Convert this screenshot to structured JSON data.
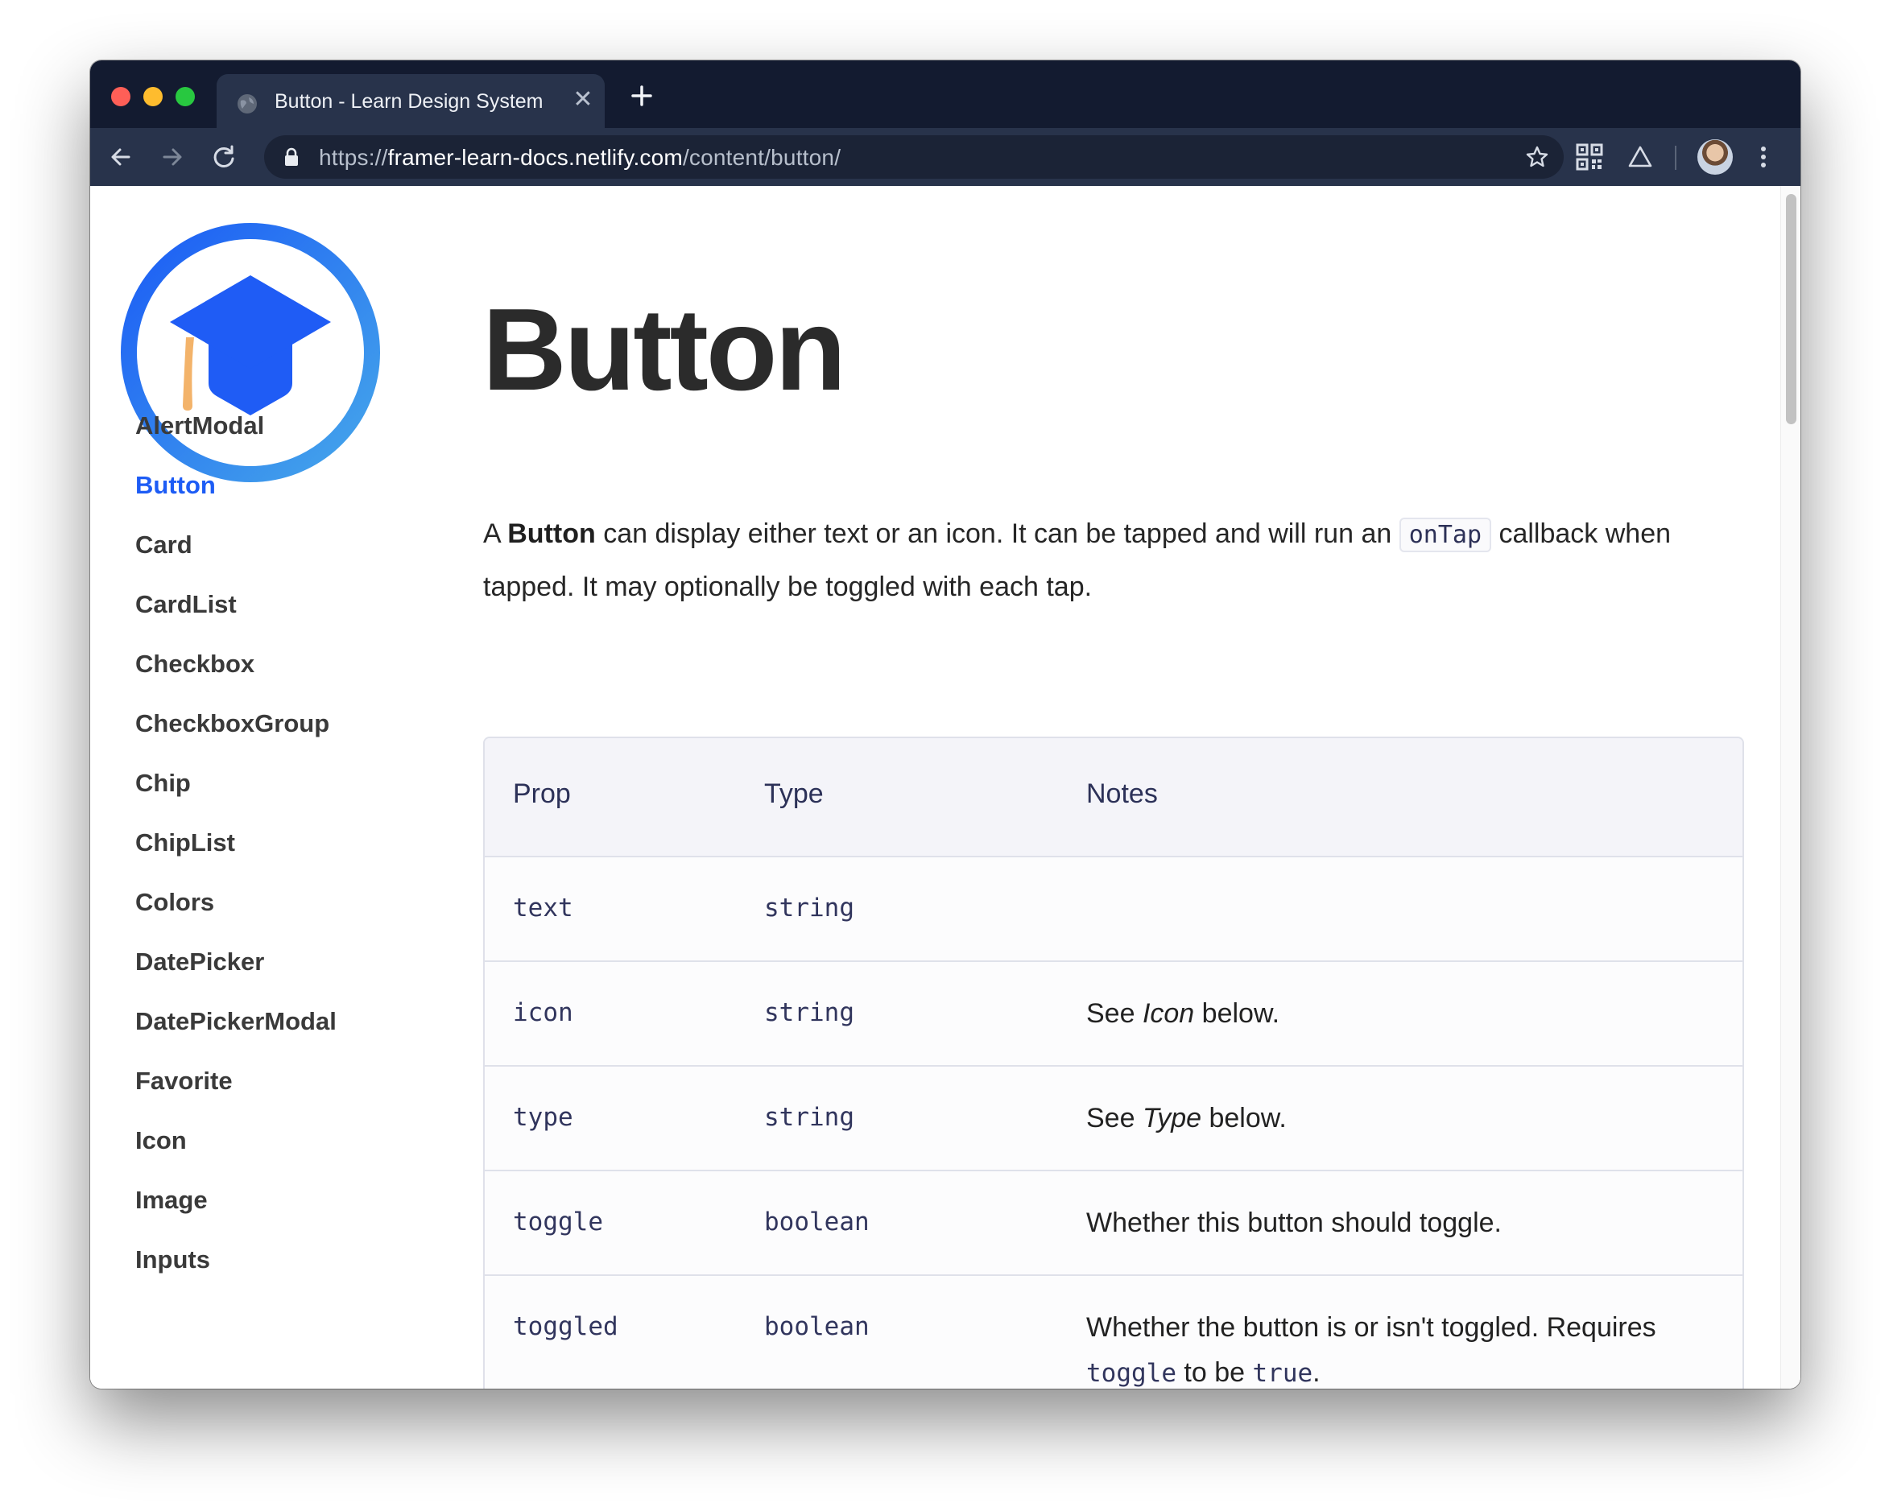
{
  "browser": {
    "tab": {
      "title": "Button - Learn Design System",
      "close_glyph": "✕"
    },
    "newtab_glyph": "+",
    "url": {
      "scheme": "https://",
      "host": "framer-learn-docs.netlify.com",
      "path": "/content/button/"
    },
    "icons": [
      "back-icon",
      "forward-icon",
      "reload-icon",
      "lock-icon",
      "star-icon",
      "qr-code-icon",
      "drive-icon",
      "profile-avatar",
      "menu-icon"
    ]
  },
  "sidebar": {
    "items": [
      {
        "label": "AlertModal",
        "active": false
      },
      {
        "label": "Button",
        "active": true
      },
      {
        "label": "Card",
        "active": false
      },
      {
        "label": "CardList",
        "active": false
      },
      {
        "label": "Checkbox",
        "active": false
      },
      {
        "label": "CheckboxGroup",
        "active": false
      },
      {
        "label": "Chip",
        "active": false
      },
      {
        "label": "ChipList",
        "active": false
      },
      {
        "label": "Colors",
        "active": false
      },
      {
        "label": "DatePicker",
        "active": false
      },
      {
        "label": "DatePickerModal",
        "active": false
      },
      {
        "label": "Favorite",
        "active": false
      },
      {
        "label": "Icon",
        "active": false
      },
      {
        "label": "Image",
        "active": false
      },
      {
        "label": "Inputs",
        "active": false
      }
    ]
  },
  "main": {
    "title": "Button",
    "intro": {
      "p1": "A ",
      "bold": "Button",
      "p2": " can display either text or an icon. It can be tapped and will run an ",
      "code": "onTap",
      "p3": " callback when tapped. It may optionally be toggled with each tap."
    },
    "table": {
      "headers": [
        "Prop",
        "Type",
        "Notes"
      ],
      "rows": [
        {
          "prop": "text",
          "type": "string",
          "note_parts": []
        },
        {
          "prop": "icon",
          "type": "string",
          "note_parts": [
            {
              "t": "See "
            },
            {
              "t": "Icon",
              "i": true
            },
            {
              "t": " below."
            }
          ]
        },
        {
          "prop": "type",
          "type": "string",
          "note_parts": [
            {
              "t": "See "
            },
            {
              "t": "Type",
              "i": true
            },
            {
              "t": " below."
            }
          ]
        },
        {
          "prop": "toggle",
          "type": "boolean",
          "note_parts": [
            {
              "t": "Whether this button should toggle."
            }
          ]
        },
        {
          "prop": "toggled",
          "type": "boolean",
          "note_parts": [
            {
              "t": "Whether the button is or isn't toggled. Requires "
            },
            {
              "t": "toggle",
              "c": true
            },
            {
              "t": " to be "
            },
            {
              "t": "true",
              "c": true
            },
            {
              "t": "."
            }
          ]
        }
      ]
    }
  },
  "colors": {
    "accent": "#1d5cf5",
    "logo_ring": "#1f63f5",
    "logo_tassel": "#f3b36a"
  }
}
